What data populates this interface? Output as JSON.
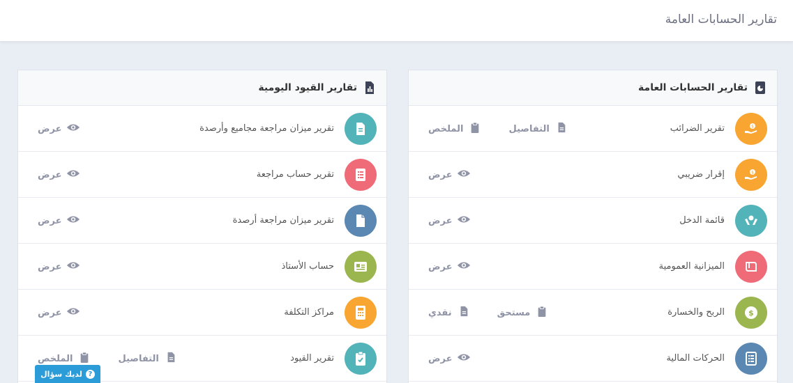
{
  "page": {
    "title": "تقارير الحسابات العامة"
  },
  "cards": [
    {
      "title": "تقارير الحسابات العامة",
      "header_icon": "pie-chart-icon",
      "rows": [
        {
          "label": "تقرير الضرائب",
          "icon": "hand-money-icon",
          "color": "#f9a531",
          "actions": [
            {
              "label": "الملخص",
              "icon": "clipboard-icon"
            },
            {
              "label": "التفاصيل",
              "icon": "file-icon"
            }
          ]
        },
        {
          "label": "إقرار ضريبي",
          "icon": "hand-money-icon",
          "color": "#f9a531",
          "actions": [
            {
              "label": "عرض",
              "icon": "eye-icon"
            }
          ]
        },
        {
          "label": "قائمة الدخل",
          "icon": "hands-coin-icon",
          "color": "#52b3b9",
          "actions": [
            {
              "label": "عرض",
              "icon": "eye-icon"
            }
          ]
        },
        {
          "label": "الميزانية العمومية",
          "icon": "scroll-icon",
          "color": "#ef6b77",
          "actions": [
            {
              "label": "عرض",
              "icon": "eye-icon"
            }
          ]
        },
        {
          "label": "الربح والخسارة",
          "icon": "dollar-badge-icon",
          "color": "#9bb54f",
          "actions": [
            {
              "label": "نقدي",
              "icon": "file-icon"
            },
            {
              "label": "مستحق",
              "icon": "clipboard-icon"
            }
          ]
        },
        {
          "label": "الحركات المالية",
          "icon": "list-icon",
          "color": "#5b87b3",
          "actions": [
            {
              "label": "عرض",
              "icon": "eye-icon"
            }
          ]
        }
      ]
    },
    {
      "title": "تقارير القيود اليومية",
      "header_icon": "file-chart-icon",
      "rows": [
        {
          "label": "تقرير ميزان مراجعة مجاميع وأرصدة",
          "icon": "document-icon",
          "color": "#52b3b9",
          "actions": [
            {
              "label": "عرض",
              "icon": "eye-icon"
            }
          ]
        },
        {
          "label": "تقرير حساب مراجعة",
          "icon": "checklist-icon",
          "color": "#ef6b77",
          "actions": [
            {
              "label": "عرض",
              "icon": "eye-icon"
            }
          ]
        },
        {
          "label": "تقرير ميزان مراجعة أرصدة",
          "icon": "file-icon",
          "color": "#5b87b3",
          "actions": [
            {
              "label": "عرض",
              "icon": "eye-icon"
            }
          ]
        },
        {
          "label": "حساب الأستاذ",
          "icon": "id-card-icon",
          "color": "#9bb54f",
          "actions": [
            {
              "label": "عرض",
              "icon": "eye-icon"
            }
          ]
        },
        {
          "label": "مراكز التكلفة",
          "icon": "calculator-icon",
          "color": "#f9a531",
          "actions": [
            {
              "label": "عرض",
              "icon": "eye-icon"
            }
          ]
        },
        {
          "label": "تقرير القيود",
          "icon": "clipboard-check-icon",
          "color": "#52b3b9",
          "actions": [
            {
              "label": "الملخص",
              "icon": "clipboard-icon"
            },
            {
              "label": "التفاصيل",
              "icon": "file-icon"
            }
          ]
        }
      ]
    }
  ],
  "help": {
    "label": "لديك سؤال",
    "icon": "question-icon"
  },
  "colors": {
    "action": "#8f93a6",
    "header_icon": "#3d4257",
    "help": "#2b9cd8"
  }
}
